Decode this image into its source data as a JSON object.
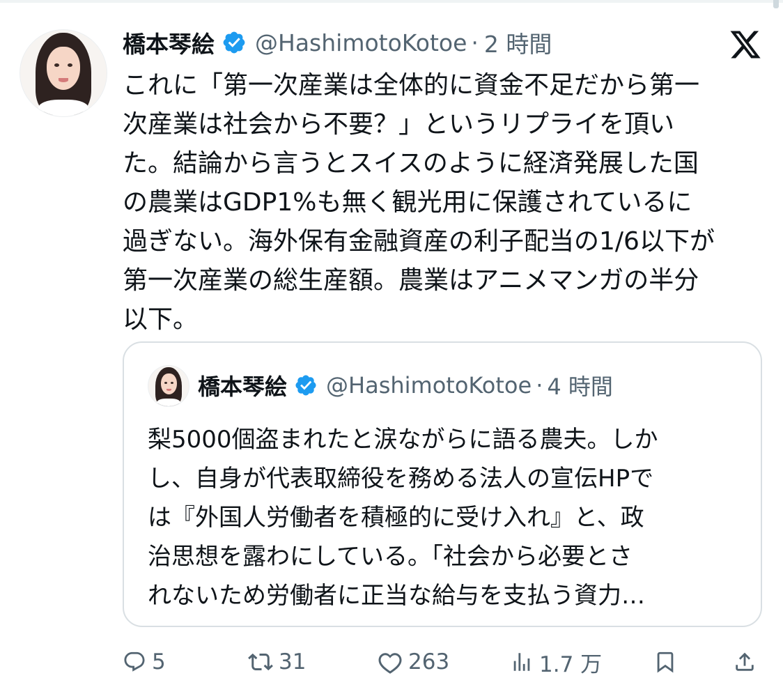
{
  "tweet": {
    "author_name": "橋本琴絵",
    "handle": "@HashimotoKotoe",
    "separator": "·",
    "time": "2 時間",
    "text": "これに「第一次産業は全体的に資金不足だから第一\n次産業は社会から不要？」というリプライを頂い\nた。結論から言うとスイスのように経済発展した国\nの農業はGDP1%も無く観光用に保護されているに\n過ぎない。海外保有金融資産の利子配当の1/6以下が\n第一次産業の総生産額。農業はアニメマンガの半分\n以下。"
  },
  "quoted_tweet": {
    "author_name": "橋本琴絵",
    "handle": "@HashimotoKotoe",
    "separator": "·",
    "time": "4 時間",
    "text": "梨5000個盗まれたと涙ながらに語る農夫。しか\nし、自身が代表取締役を務める法人の宣伝HPで\nは『外国人労働者を積極的に受け入れ』と、政\n治思想を露わにしている。「社会から必要とさ\nれないため労働者に正当な給与を支払う資力…"
  },
  "actions": {
    "replies": "5",
    "reposts": "31",
    "likes": "263",
    "views": "1.7 万"
  },
  "icons": {
    "verified": "verified-badge-icon",
    "logo": "x-logo-icon",
    "reply": "reply-icon",
    "repost": "repost-icon",
    "like": "heart-icon",
    "views": "views-chart-icon",
    "bookmark": "bookmark-icon",
    "share": "share-icon"
  },
  "colors": {
    "verified_blue": "#1d9bf0",
    "text_primary": "#0f1419",
    "text_secondary": "#536471",
    "border": "#d9dfe3"
  }
}
